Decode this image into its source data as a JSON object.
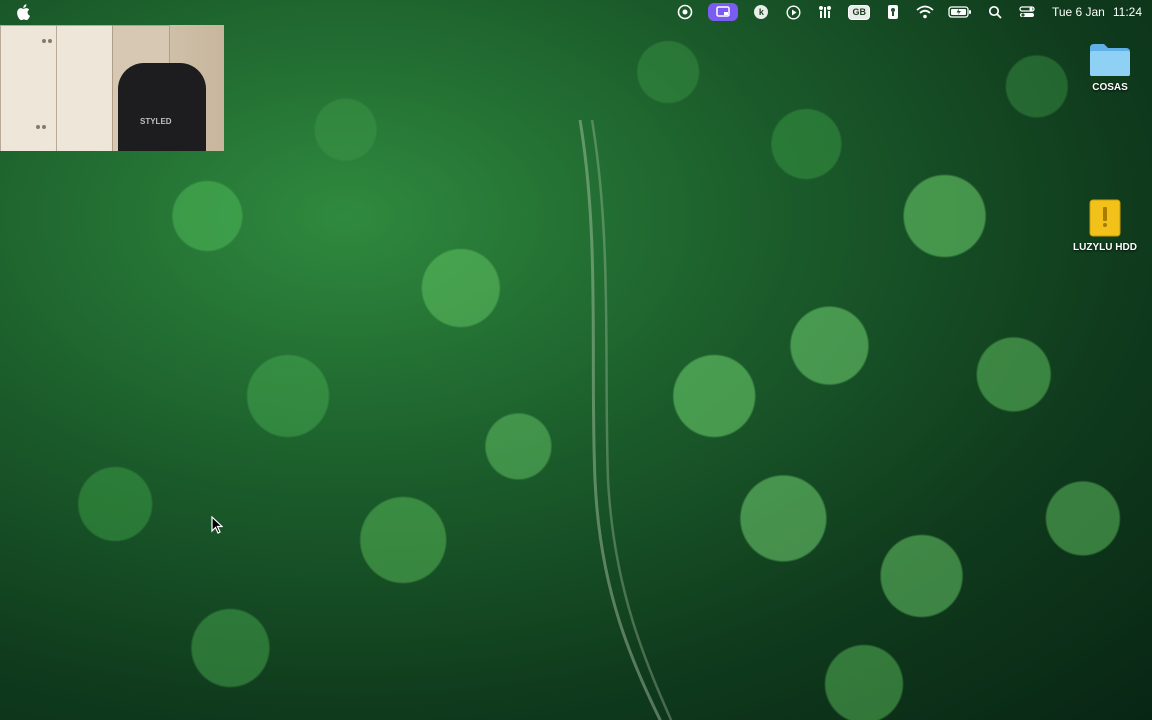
{
  "menubar": {
    "left_icon": "apple-icon",
    "status_icons": [
      "creative-cloud-icon",
      "screen-recording-icon",
      "k-icon",
      "play-icon",
      "control-icon",
      "input-source-icon",
      "keychain-icon",
      "wifi-icon",
      "battery-icon",
      "spotlight-icon",
      "control-center-icon"
    ],
    "input_source_label": "GB",
    "k_label": "k",
    "date": "Tue 6 Jan",
    "time": "11:24"
  },
  "desktop": {
    "items": [
      {
        "label": "COSAS",
        "icon": "folder-icon",
        "color": "#7cc6ef"
      },
      {
        "label": "LUZYLU HDD",
        "icon": "external-drive-icon",
        "color": "#f2c21a"
      }
    ]
  },
  "camera_overlay": {
    "chair_logo": "STYLED"
  },
  "colors": {
    "accent": "#7b5cf0"
  }
}
